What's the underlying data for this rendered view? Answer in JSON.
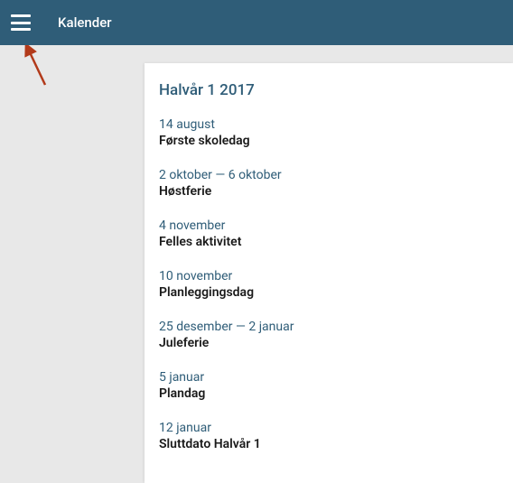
{
  "header": {
    "title": "Kalender"
  },
  "card": {
    "title": "Halvår 1 2017",
    "events": [
      {
        "date": "14 august",
        "label": "Første skoledag"
      },
      {
        "date": "2 oktober — 6 oktober",
        "label": "Høstferie"
      },
      {
        "date": "4 november",
        "label": "Felles aktivitet"
      },
      {
        "date": "10 november",
        "label": "Planleggingsdag"
      },
      {
        "date": "25 desember — 2 januar",
        "label": "Juleferie"
      },
      {
        "date": "5 januar",
        "label": "Plandag"
      },
      {
        "date": "12 januar",
        "label": "Sluttdato Halvår 1"
      }
    ]
  },
  "annotation": {
    "arrow_color": "#b23a1a"
  }
}
